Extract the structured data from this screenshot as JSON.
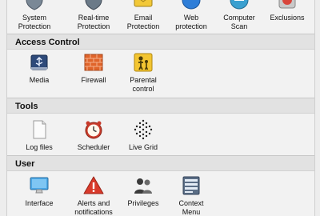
{
  "top_row": {
    "items": [
      {
        "label": "System\nProtection",
        "icon": "shield-icon"
      },
      {
        "label": "Real-time\nProtection",
        "icon": "shield-realtime-icon"
      },
      {
        "label": "Email\nProtection",
        "icon": "email-icon"
      },
      {
        "label": "Web\nprotection",
        "icon": "globe-icon"
      },
      {
        "label": "Computer\nScan",
        "icon": "scan-icon"
      },
      {
        "label": "Exclusions",
        "icon": "exclusions-icon"
      }
    ]
  },
  "access_control": {
    "title": "Access Control",
    "items": [
      {
        "label": "Media",
        "icon": "usb-media-icon"
      },
      {
        "label": "Firewall",
        "icon": "firewall-brick-icon"
      },
      {
        "label": "Parental\ncontrol",
        "icon": "parental-control-icon"
      }
    ]
  },
  "tools": {
    "title": "Tools",
    "items": [
      {
        "label": "Log files",
        "icon": "document-icon"
      },
      {
        "label": "Scheduler",
        "icon": "alarm-clock-icon"
      },
      {
        "label": "Live Grid",
        "icon": "live-grid-icon"
      }
    ]
  },
  "user": {
    "title": "User",
    "items": [
      {
        "label": "Interface",
        "icon": "monitor-icon"
      },
      {
        "label": "Alerts and\nnotifications",
        "icon": "warning-icon"
      },
      {
        "label": "Privileges",
        "icon": "users-icon"
      },
      {
        "label": "Context\nMenu",
        "icon": "context-menu-icon"
      }
    ]
  }
}
